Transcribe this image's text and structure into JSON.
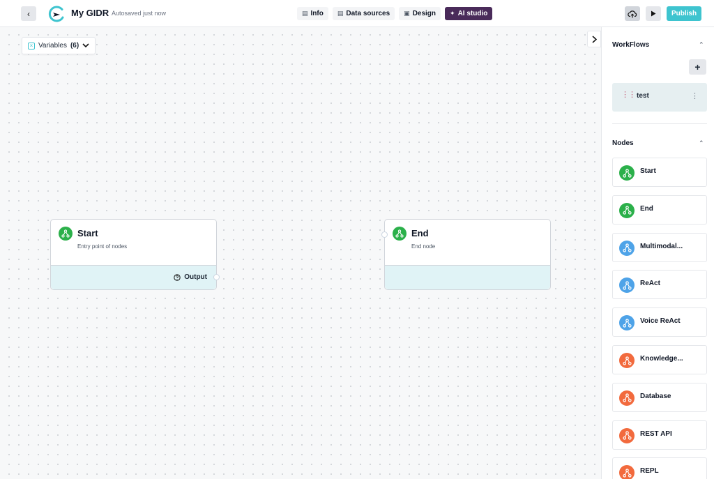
{
  "topbar": {
    "back_icon": "chevron-left-icon",
    "logo_icon": "app-logo",
    "app_title": "My GIDR",
    "autosave": "Autosaved just now",
    "tabs": [
      {
        "label": "Info",
        "icon": "document-icon"
      },
      {
        "label": "Data sources",
        "icon": "database-icon"
      },
      {
        "label": "Design",
        "icon": "image-icon"
      },
      {
        "label": "AI studio",
        "icon": "sparkle-icon",
        "active": true
      }
    ],
    "publish_label": "Publish",
    "colors": {
      "accent": "#3ec4cf",
      "ai_tab": "#4a2b5a"
    }
  },
  "canvas": {
    "variables_label": "Variables",
    "variables_count": "(6)",
    "nodes": [
      {
        "title": "Start",
        "subtitle": "Entry point of nodes",
        "output_label": "Output"
      },
      {
        "title": "End",
        "subtitle": "End node"
      }
    ]
  },
  "sidebar": {
    "workflows_title": "WorkFlows",
    "add_label": "+",
    "workflows": [
      {
        "name": "test"
      }
    ],
    "nodes_title": "Nodes",
    "node_types": [
      {
        "label": "Start",
        "color": "#2bb04a"
      },
      {
        "label": "End",
        "color": "#2bb04a"
      },
      {
        "label": "Multimodal...",
        "color": "#4ea3e8"
      },
      {
        "label": "ReAct",
        "color": "#4ea3e8"
      },
      {
        "label": "Voice ReAct",
        "color": "#4ea3e8"
      },
      {
        "label": "Knowledge...",
        "color": "#f26a3d"
      },
      {
        "label": "Database",
        "color": "#f26a3d"
      },
      {
        "label": "REST API",
        "color": "#f26a3d"
      },
      {
        "label": "REPL",
        "color": "#f26a3d"
      }
    ]
  }
}
